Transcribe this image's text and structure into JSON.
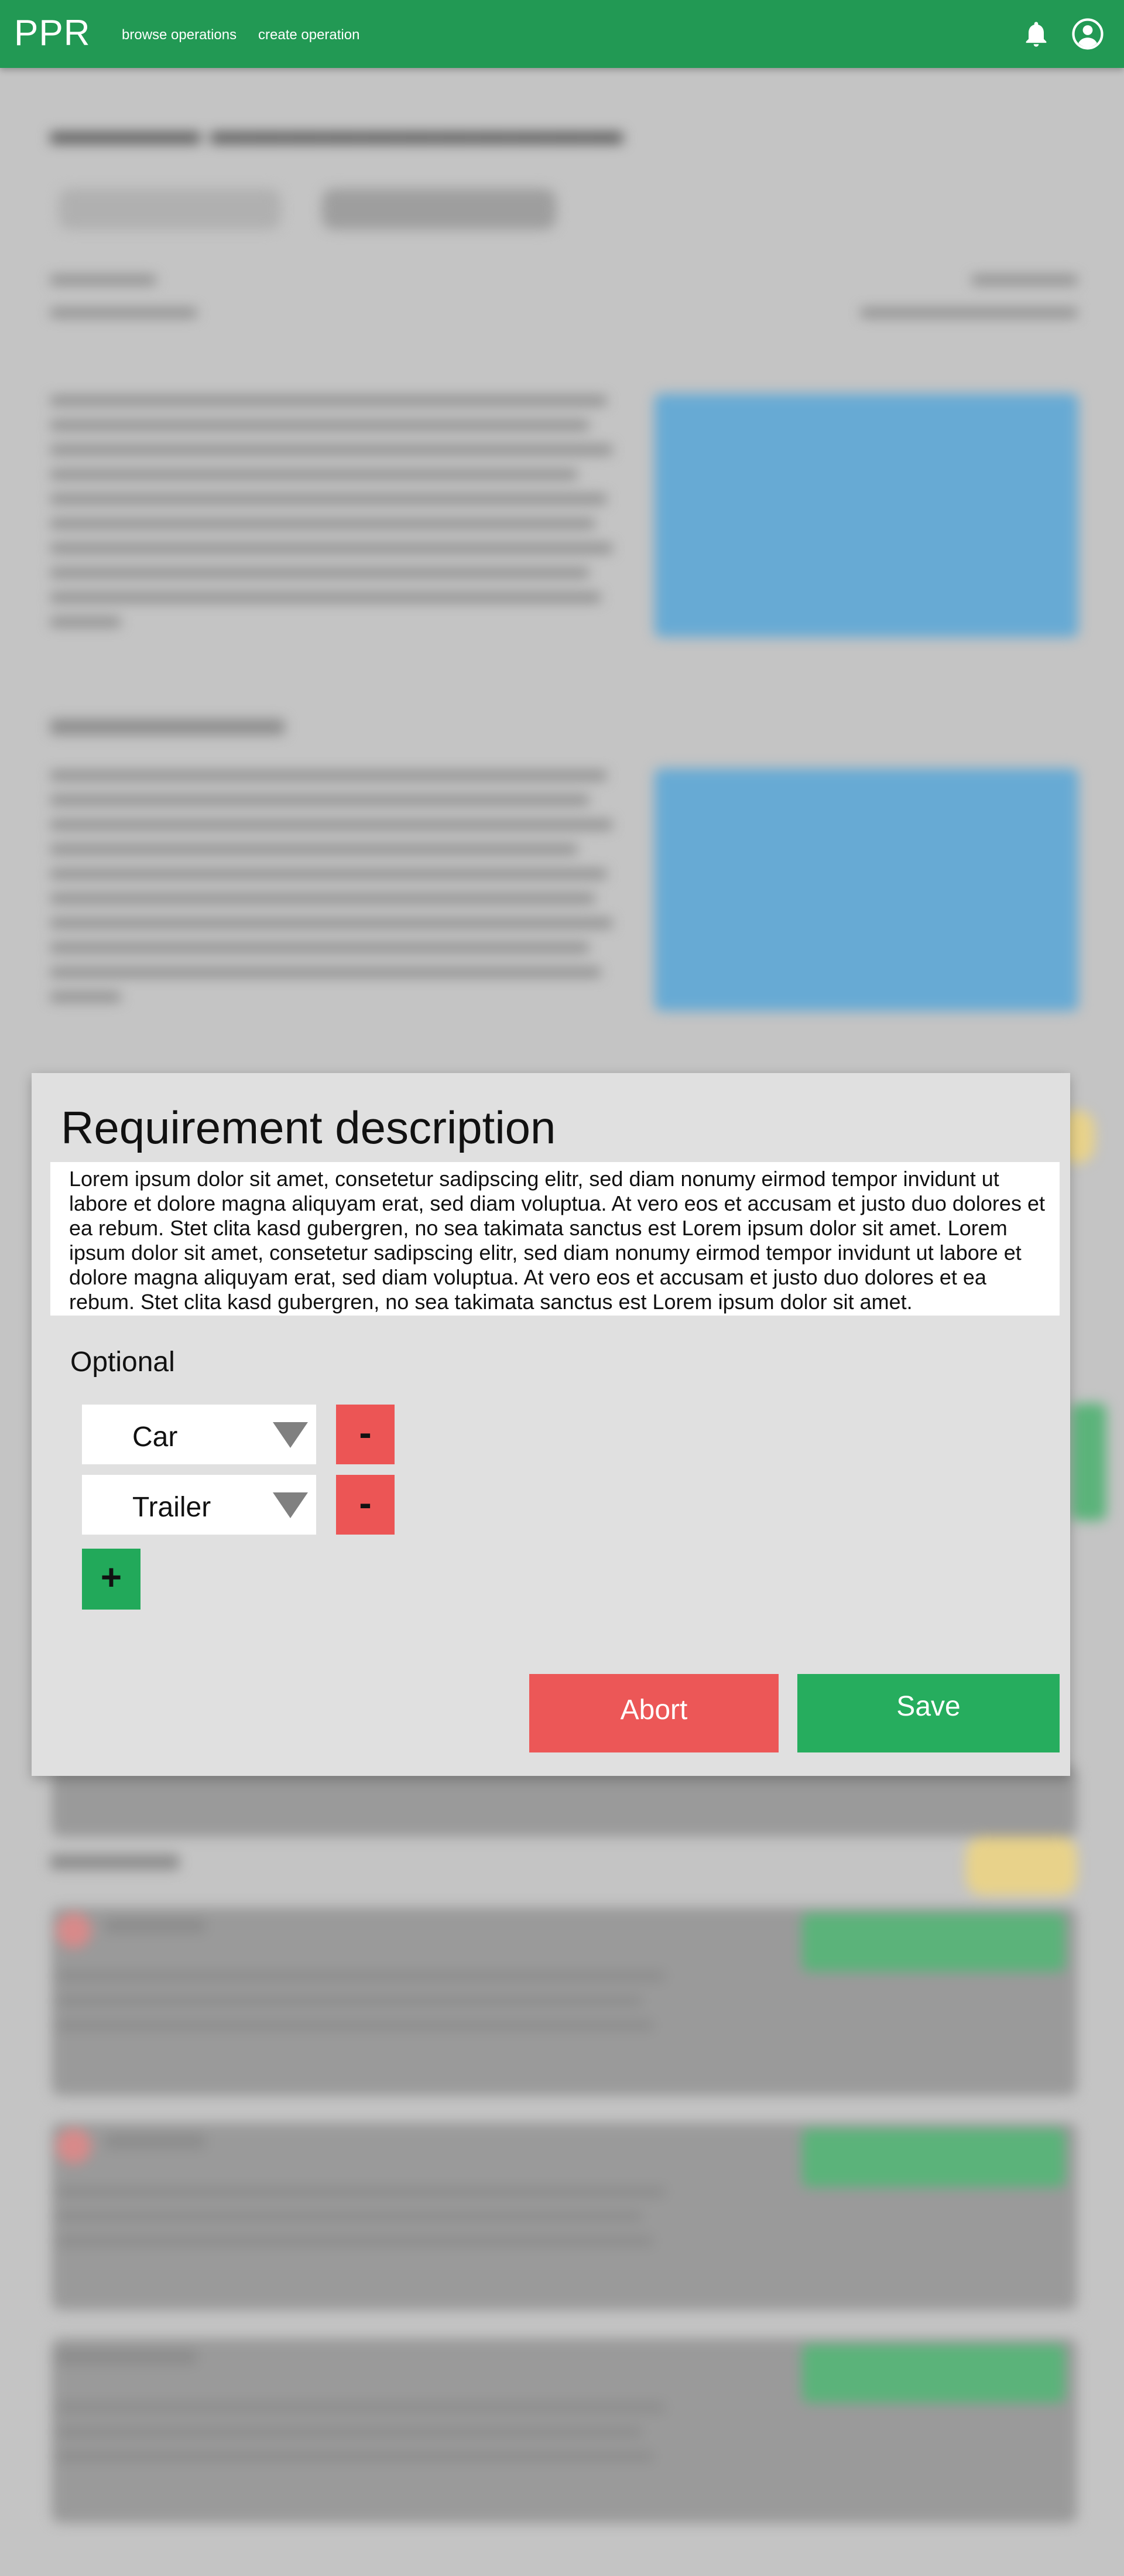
{
  "app": {
    "logo": "PPR"
  },
  "nav": {
    "browse": "browse operations",
    "create": "create operation"
  },
  "icons": {
    "notifications": "bell-icon",
    "account": "user-circle-icon",
    "dropdown": "triangle-down-icon"
  },
  "colors": {
    "topbar": "#229954",
    "danger": "#ec5555",
    "success": "#26ad5e",
    "backdrop_image": "#67aad4"
  },
  "modal": {
    "title": "Requirement description",
    "description": "Lorem ipsum dolor sit amet, consetetur sadipscing elitr, sed diam nonumy eirmod tempor invidunt ut labore et dolore magna aliquyam erat, sed diam voluptua. At vero eos et accusam et justo duo dolores et ea rebum. Stet clita kasd gubergren, no sea takimata sanctus est Lorem ipsum dolor sit amet. Lorem ipsum dolor sit amet, consetetur sadipscing elitr, sed diam nonumy eirmod tempor invidunt ut labore et dolore magna aliquyam erat, sed diam voluptua. At vero eos et accusam et justo duo dolores et ea rebum. Stet clita kasd gubergren, no sea takimata sanctus est Lorem ipsum dolor sit amet.",
    "optional_label": "Optional",
    "items": [
      {
        "value": "Car"
      },
      {
        "value": "Trailer"
      }
    ],
    "remove_label": "-",
    "add_label": "+",
    "abort_label": "Abort",
    "save_label": "Save"
  }
}
